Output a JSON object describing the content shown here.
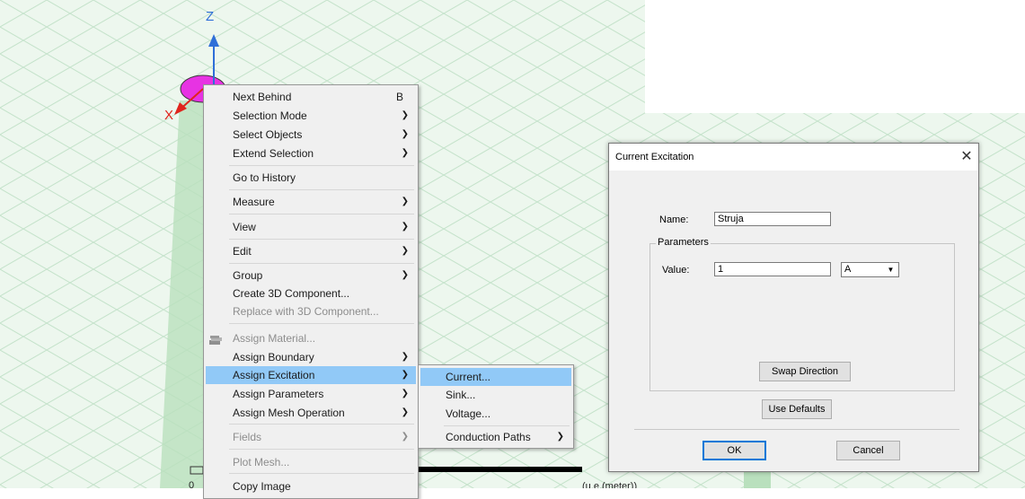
{
  "viewport": {
    "axis_z_label": "Z",
    "axis_x_label": "X",
    "ruler_zero_label": "0",
    "ruler_unit_label": "(u.e.(meter))",
    "colors": {
      "grid_bg": "#edf7ee",
      "grid_lines": "#c5e3cb",
      "object_fill": "#e733e3",
      "axis_z": "#2f6fd8",
      "axis_x": "#e0241d"
    }
  },
  "context_menu": {
    "items": [
      {
        "label": "Next Behind",
        "accelerator": "B",
        "submenu": false,
        "disabled": false
      },
      {
        "label": "Selection Mode",
        "submenu": true,
        "disabled": false
      },
      {
        "label": "Select Objects",
        "submenu": true,
        "disabled": false
      },
      {
        "label": "Extend Selection",
        "submenu": true,
        "disabled": false
      },
      {
        "label": "Go to History",
        "submenu": false,
        "disabled": false
      },
      {
        "label": "Measure",
        "submenu": true,
        "disabled": false
      },
      {
        "label": "View",
        "submenu": true,
        "disabled": false
      },
      {
        "label": "Edit",
        "submenu": true,
        "disabled": false
      },
      {
        "label": "Group",
        "submenu": true,
        "disabled": false
      },
      {
        "label": "Create 3D Component...",
        "submenu": false,
        "disabled": false
      },
      {
        "label": "Replace with 3D Component...",
        "submenu": false,
        "disabled": true
      },
      {
        "label": "Assign Material...",
        "submenu": false,
        "disabled": true,
        "icon": "material-icon"
      },
      {
        "label": "Assign Boundary",
        "submenu": true,
        "disabled": false
      },
      {
        "label": "Assign Excitation",
        "submenu": true,
        "disabled": false,
        "highlighted": true
      },
      {
        "label": "Assign Parameters",
        "submenu": true,
        "disabled": false
      },
      {
        "label": "Assign Mesh Operation",
        "submenu": true,
        "disabled": false
      },
      {
        "label": "Fields",
        "submenu": true,
        "disabled": true
      },
      {
        "label": "Plot Mesh...",
        "submenu": false,
        "disabled": true
      },
      {
        "label": "Copy Image",
        "submenu": false,
        "disabled": false
      }
    ]
  },
  "excitation_submenu": {
    "items": [
      {
        "label": "Current...",
        "highlighted": true,
        "submenu": false
      },
      {
        "label": "Sink...",
        "submenu": false
      },
      {
        "label": "Voltage...",
        "submenu": false
      },
      {
        "label": "Conduction Paths",
        "submenu": true
      }
    ]
  },
  "dialog": {
    "title": "Current Excitation",
    "close_glyph": "✕",
    "name_label": "Name:",
    "name_value": "Struja",
    "parameters_label": "Parameters",
    "value_label": "Value:",
    "value_value": "1",
    "unit_value": "A",
    "swap_direction_label": "Swap Direction",
    "use_defaults_label": "Use Defaults",
    "ok_label": "OK",
    "cancel_label": "Cancel",
    "accent_color": "#0078d7"
  }
}
